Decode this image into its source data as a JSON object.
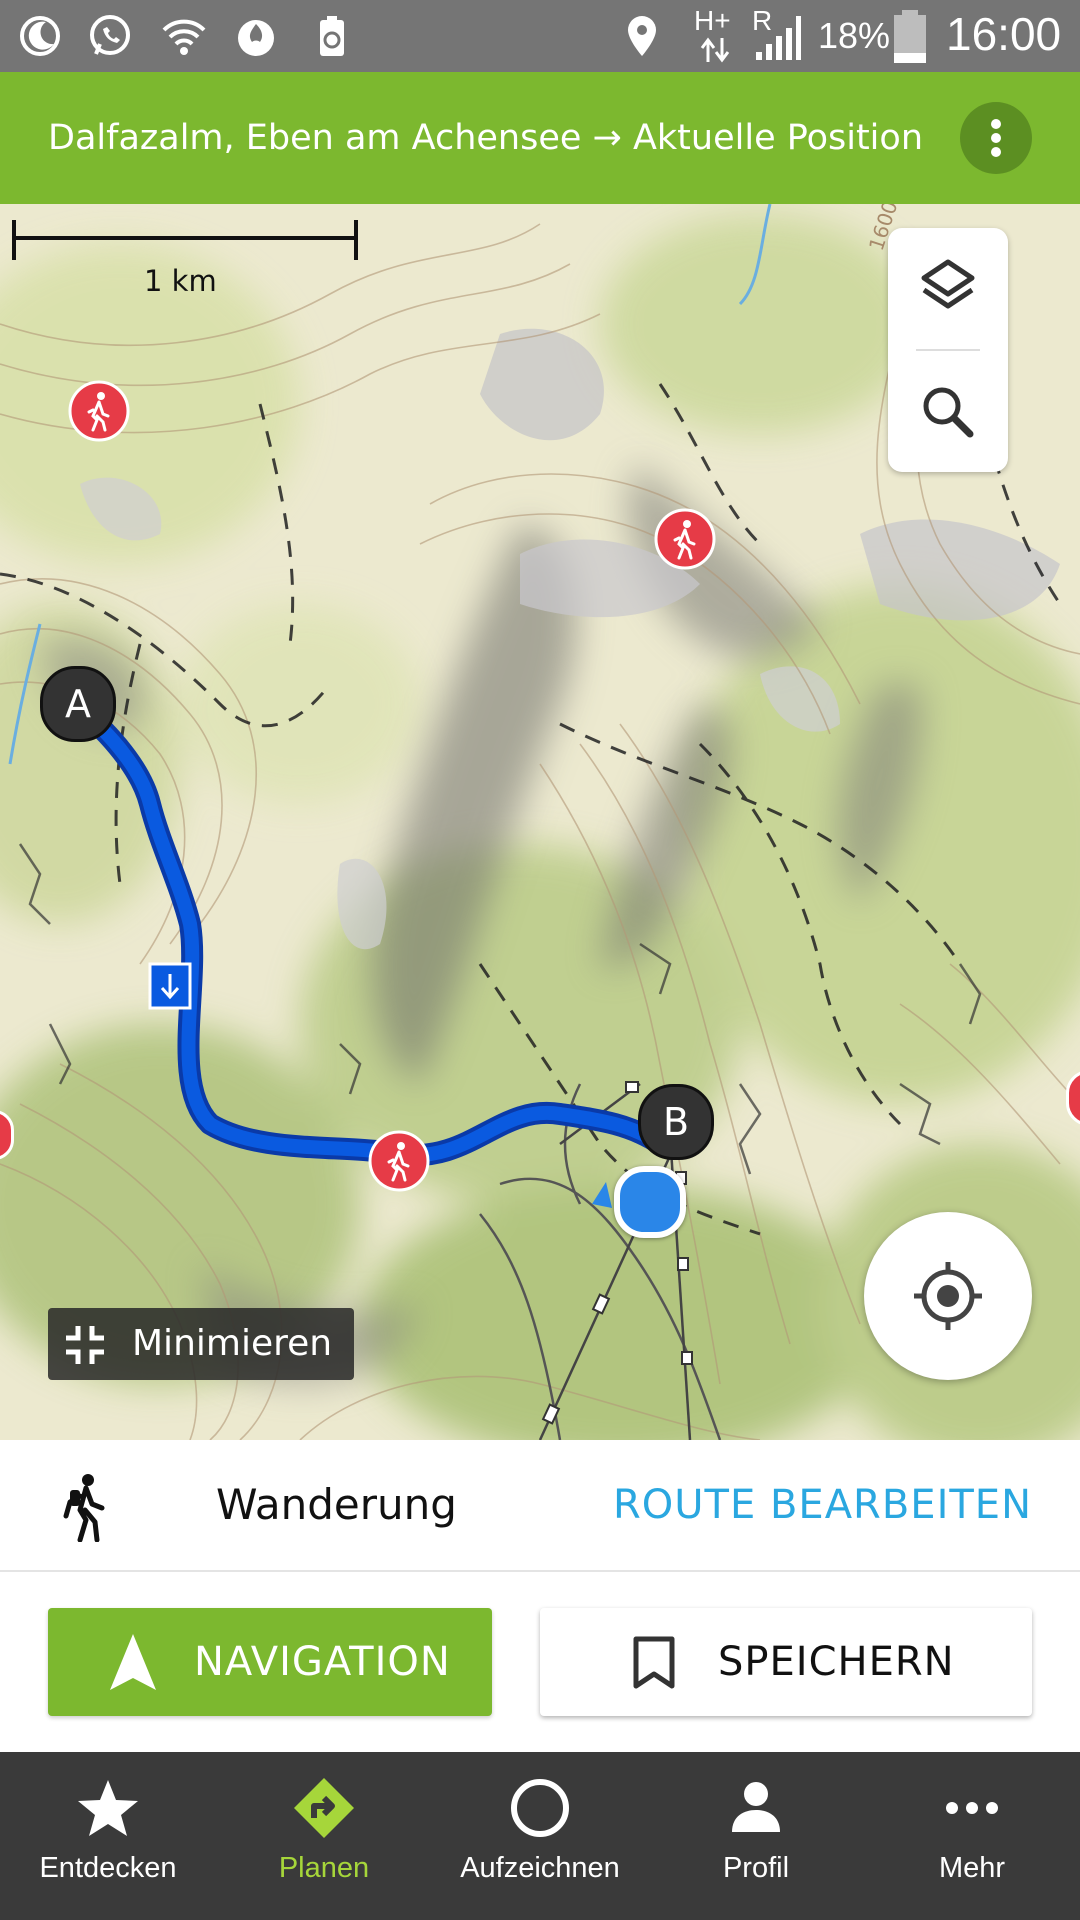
{
  "status_bar": {
    "network": "H+",
    "roaming": "R",
    "battery": "18%",
    "time": "16:00"
  },
  "header": {
    "title": "Dalfazalm, Eben am Achensee → Aktuelle Position"
  },
  "map": {
    "scale_label": "1 km",
    "contour_label": "1600",
    "start_marker": "A",
    "end_marker": "B",
    "minimize_label": "Minimieren"
  },
  "route_type": {
    "label": "Wanderung",
    "edit_label": "ROUTE BEARBEITEN"
  },
  "actions": {
    "navigation_label": "NAVIGATION",
    "save_label": "SPEICHERN"
  },
  "bottom_nav": {
    "items": [
      {
        "label": "Entdecken"
      },
      {
        "label": "Planen"
      },
      {
        "label": "Aufzeichnen"
      },
      {
        "label": "Profil"
      },
      {
        "label": "Mehr"
      }
    ],
    "active": "Planen"
  },
  "colors": {
    "brand_green": "#7cb82f",
    "route_blue": "#0a52d6",
    "link_blue": "#2aa7e0",
    "active_tab": "#a6d63a",
    "poi_red": "#e63b47"
  }
}
